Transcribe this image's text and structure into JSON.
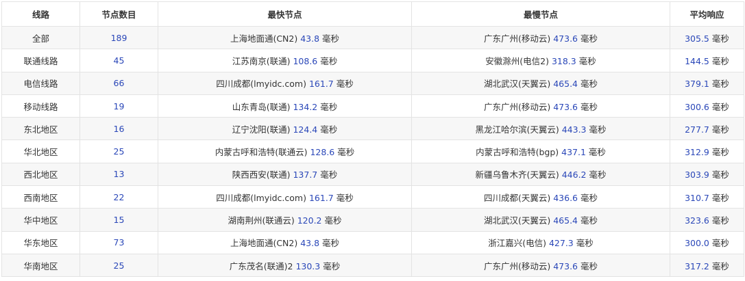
{
  "table": {
    "headers": [
      "线路",
      "节点数目",
      "最快节点",
      "最慢节点",
      "平均响应"
    ],
    "unit": "毫秒",
    "rows": [
      {
        "line": "全部",
        "count": "189",
        "fast_name": "上海地面通(CN2)",
        "fast_ms": "43.8",
        "slow_name": "广东广州(移动云)",
        "slow_ms": "473.6",
        "avg_ms": "305.5"
      },
      {
        "line": "联通线路",
        "count": "45",
        "fast_name": "江苏南京(联通)",
        "fast_ms": "108.6",
        "slow_name": "安徽滁州(电信2)",
        "slow_ms": "318.3",
        "avg_ms": "144.5"
      },
      {
        "line": "电信线路",
        "count": "66",
        "fast_name": "四川成都(lmyidc.com)",
        "fast_ms": "161.7",
        "slow_name": "湖北武汉(天翼云)",
        "slow_ms": "465.4",
        "avg_ms": "379.1"
      },
      {
        "line": "移动线路",
        "count": "19",
        "fast_name": "山东青岛(联通)",
        "fast_ms": "134.2",
        "slow_name": "广东广州(移动云)",
        "slow_ms": "473.6",
        "avg_ms": "300.6"
      },
      {
        "line": "东北地区",
        "count": "16",
        "fast_name": "辽宁沈阳(联通)",
        "fast_ms": "124.4",
        "slow_name": "黑龙江哈尔滨(天翼云)",
        "slow_ms": "443.3",
        "avg_ms": "277.7"
      },
      {
        "line": "华北地区",
        "count": "25",
        "fast_name": "内蒙古呼和浩特(联通云)",
        "fast_ms": "128.6",
        "slow_name": "内蒙古呼和浩特(bgp)",
        "slow_ms": "437.1",
        "avg_ms": "312.9"
      },
      {
        "line": "西北地区",
        "count": "13",
        "fast_name": "陕西西安(联通)",
        "fast_ms": "137.7",
        "slow_name": "新疆乌鲁木齐(天翼云)",
        "slow_ms": "446.2",
        "avg_ms": "303.9"
      },
      {
        "line": "西南地区",
        "count": "22",
        "fast_name": "四川成都(lmyidc.com)",
        "fast_ms": "161.7",
        "slow_name": "四川成都(天翼云)",
        "slow_ms": "436.6",
        "avg_ms": "310.7"
      },
      {
        "line": "华中地区",
        "count": "15",
        "fast_name": "湖南荆州(联通云)",
        "fast_ms": "120.2",
        "slow_name": "湖北武汉(天翼云)",
        "slow_ms": "465.4",
        "avg_ms": "323.6"
      },
      {
        "line": "华东地区",
        "count": "73",
        "fast_name": "上海地面通(CN2)",
        "fast_ms": "43.8",
        "slow_name": "浙江嘉兴(电信)",
        "slow_ms": "427.3",
        "avg_ms": "300.0"
      },
      {
        "line": "华南地区",
        "count": "25",
        "fast_name": "广东茂名(联通)2",
        "fast_ms": "130.3",
        "slow_name": "广东广州(移动云)",
        "slow_ms": "473.6",
        "avg_ms": "317.2"
      }
    ]
  }
}
